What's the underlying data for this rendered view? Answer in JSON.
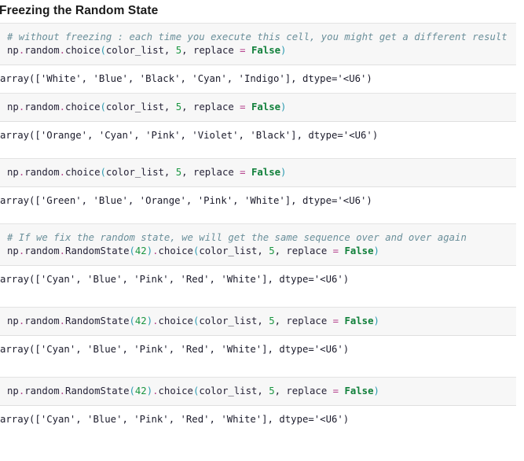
{
  "document": {
    "type": "jupyter-notebook",
    "heading": "Freezing the Random State"
  },
  "theme": {
    "code_cell_background": "#f7f7f7",
    "output_background": "#ffffff",
    "cell_border": "#e3e3e3",
    "comment_color": "#6a8f9a",
    "number_color": "#1a9641",
    "keyword_color": "#11803b",
    "operator_color": "#b5418c",
    "punctuation_color": "#2b9ab0",
    "text_color": "#262338"
  },
  "cells": [
    {
      "id": "cell-1",
      "comment": "# without freezing : each time you execute this cell, you might get a different result",
      "code": {
        "prefix": "np",
        "dot1": ".",
        "module": "random",
        "dot2": ".",
        "func": "choice",
        "open_paren": "(",
        "arg1": "color_list, ",
        "num": "5",
        "comma": ", ",
        "kwarg": "replace ",
        "eq": "=",
        "space": " ",
        "value": "False",
        "close_paren": ")"
      },
      "output": "array(['White', 'Blue', 'Black', 'Cyan', 'Indigo'], dtype='<U6')"
    },
    {
      "id": "cell-2",
      "comment": "",
      "code": {
        "prefix": "np",
        "dot1": ".",
        "module": "random",
        "dot2": ".",
        "func": "choice",
        "open_paren": "(",
        "arg1": "color_list, ",
        "num": "5",
        "comma": ", ",
        "kwarg": "replace ",
        "eq": "=",
        "space": " ",
        "value": "False",
        "close_paren": ")"
      },
      "output": "array(['Orange', 'Cyan', 'Pink', 'Violet', 'Black'], dtype='<U6')"
    },
    {
      "id": "cell-3",
      "comment": "",
      "code": {
        "prefix": "np",
        "dot1": ".",
        "module": "random",
        "dot2": ".",
        "func": "choice",
        "open_paren": "(",
        "arg1": "color_list, ",
        "num": "5",
        "comma": ", ",
        "kwarg": "replace ",
        "eq": "=",
        "space": " ",
        "value": "False",
        "close_paren": ")"
      },
      "output": "array(['Green', 'Blue', 'Orange', 'Pink', 'White'], dtype='<U6')"
    },
    {
      "id": "cell-4",
      "comment": "# If we fix the random state, we will get the same sequence over and over again",
      "code": {
        "prefix": "np",
        "dot1": ".",
        "module": "random",
        "dot2": ".",
        "func": "RandomState",
        "open_paren": "(",
        "seed": "42",
        "close_seed": ")",
        "dot3": ".",
        "func2": "choice",
        "open_paren2": "(",
        "arg1": "color_list, ",
        "num": "5",
        "comma": ", ",
        "kwarg": "replace ",
        "eq": "=",
        "space": " ",
        "value": "False",
        "close_paren": ")"
      },
      "output": "array(['Cyan', 'Blue', 'Pink', 'Red', 'White'], dtype='<U6')"
    },
    {
      "id": "cell-5",
      "comment": "",
      "code": {
        "prefix": "np",
        "dot1": ".",
        "module": "random",
        "dot2": ".",
        "func": "RandomState",
        "open_paren": "(",
        "seed": "42",
        "close_seed": ")",
        "dot3": ".",
        "func2": "choice",
        "open_paren2": "(",
        "arg1": "color_list, ",
        "num": "5",
        "comma": ", ",
        "kwarg": "replace ",
        "eq": "=",
        "space": " ",
        "value": "False",
        "close_paren": ")"
      },
      "output": "array(['Cyan', 'Blue', 'Pink', 'Red', 'White'], dtype='<U6')"
    },
    {
      "id": "cell-6",
      "comment": "",
      "code": {
        "prefix": "np",
        "dot1": ".",
        "module": "random",
        "dot2": ".",
        "func": "RandomState",
        "open_paren": "(",
        "seed": "42",
        "close_seed": ")",
        "dot3": ".",
        "func2": "choice",
        "open_paren2": "(",
        "arg1": "color_list, ",
        "num": "5",
        "comma": ", ",
        "kwarg": "replace ",
        "eq": "=",
        "space": " ",
        "value": "False",
        "close_paren": ")"
      },
      "output": "array(['Cyan', 'Blue', 'Pink', 'Red', 'White'], dtype='<U6')"
    }
  ]
}
